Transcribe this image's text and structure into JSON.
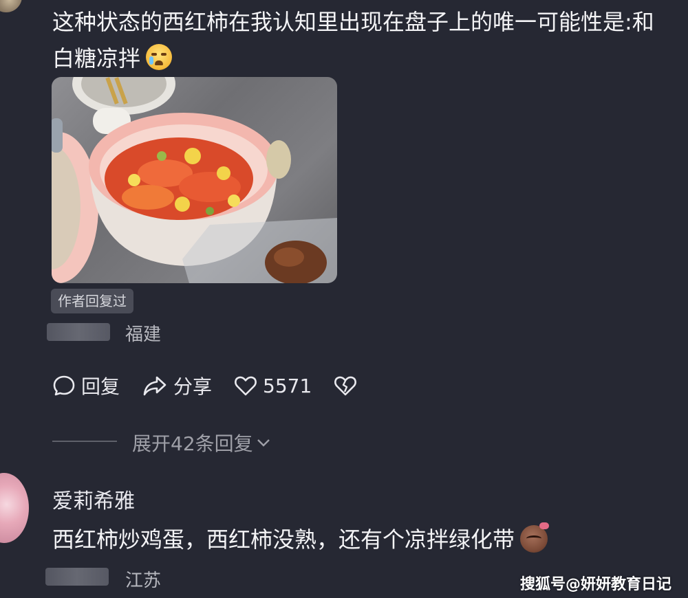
{
  "comment1": {
    "text": "这种状态的西红柿在我认知里出现在盘子上的唯一可能性是:和白糖凉拌",
    "emoji": "crying-face-emoji",
    "badge": "作者回复过",
    "location": "福建"
  },
  "actions": {
    "reply": "回复",
    "share": "分享",
    "likes": "5571"
  },
  "expand": {
    "label": "展开42条回复"
  },
  "comment2": {
    "username": "爱莉希雅",
    "text": "西红柿炒鸡蛋，西红柿没熟，还有个凉拌绿化带",
    "emoji": "brown-face-emoji",
    "location": "江苏"
  },
  "watermark": "搜狐号@妍妍教育日记",
  "colors": {
    "background": "#262833",
    "text": "#f4f4f6",
    "muted": "#9fa0a8"
  }
}
